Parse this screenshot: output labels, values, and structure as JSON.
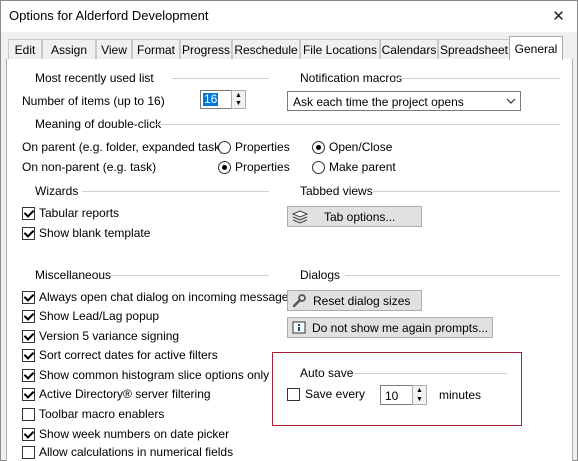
{
  "window": {
    "title": "Options for Alderford Development",
    "close_glyph": "✕"
  },
  "tabs": [
    {
      "label": "Edit"
    },
    {
      "label": "Assign"
    },
    {
      "label": "View"
    },
    {
      "label": "Format"
    },
    {
      "label": "Progress"
    },
    {
      "label": "Reschedule"
    },
    {
      "label": "File Locations"
    },
    {
      "label": "Calendars"
    },
    {
      "label": "Spreadsheet"
    },
    {
      "label": "General",
      "active": true
    }
  ],
  "mru": {
    "title": "Most recently used list",
    "label": "Number of items (up to 16)",
    "value": "16"
  },
  "notification": {
    "title": "Notification macros",
    "selected": "Ask each time the project opens"
  },
  "double_click": {
    "title": "Meaning of double-click",
    "parent_label": "On parent (e.g. folder, expanded task)",
    "nonparent_label": "On non-parent (e.g. task)",
    "properties": "Properties",
    "open_close": "Open/Close",
    "make_parent": "Make parent",
    "parent_choice": "Open/Close",
    "nonparent_choice": "Properties"
  },
  "wizards": {
    "title": "Wizards",
    "items": [
      {
        "label": "Tabular reports",
        "checked": true
      },
      {
        "label": "Show blank template",
        "checked": true
      }
    ]
  },
  "tabbed_views": {
    "title": "Tabbed views",
    "button": "Tab options..."
  },
  "misc": {
    "title": "Miscellaneous",
    "items": [
      {
        "label": "Always open chat dialog on incoming message",
        "checked": true
      },
      {
        "label": "Show Lead/Lag popup",
        "checked": true
      },
      {
        "label": "Version 5 variance signing",
        "checked": true
      },
      {
        "label": "Sort correct dates for active filters",
        "checked": true
      },
      {
        "label": "Show common histogram slice options only",
        "checked": true
      },
      {
        "label": "Active Directory® server filtering",
        "checked": true
      },
      {
        "label": "Toolbar macro enablers",
        "checked": false
      },
      {
        "label": "Show week numbers on date picker",
        "checked": true
      },
      {
        "label": "Allow calculations in numerical fields",
        "checked": false
      }
    ]
  },
  "dialogs": {
    "title": "Dialogs",
    "reset_button": "Reset dialog sizes",
    "prompts_button": "Do not show me again prompts..."
  },
  "auto_save": {
    "title": "Auto save",
    "checkbox_label": "Save every",
    "checked": false,
    "value": "10",
    "unit": "minutes"
  },
  "colors": {
    "highlight": "#a51d36",
    "selection": "#0078d7"
  }
}
